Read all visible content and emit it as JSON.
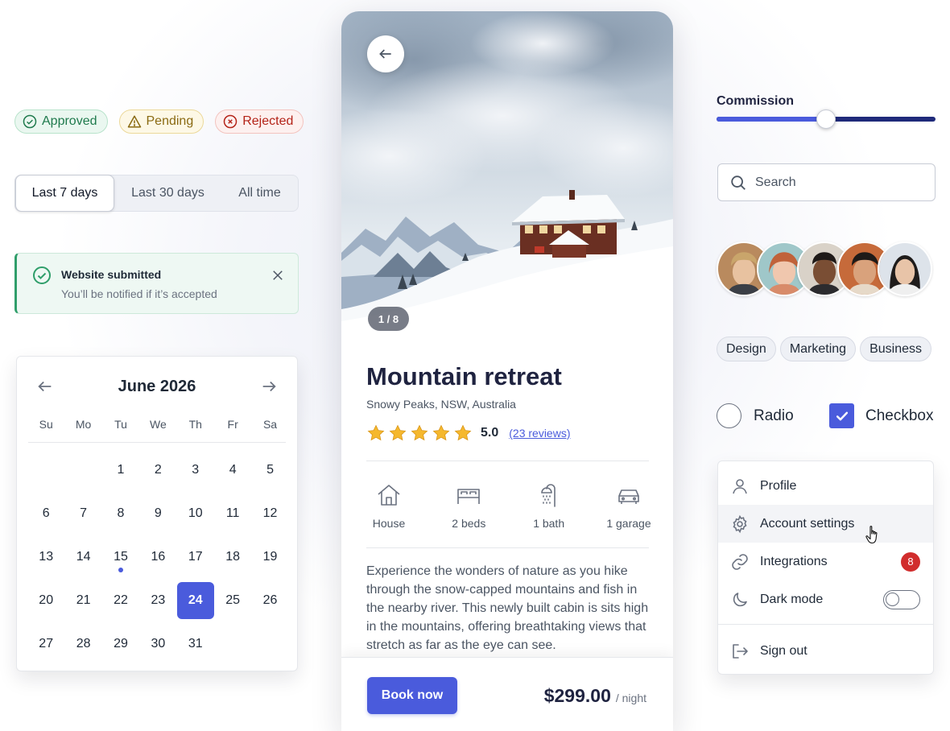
{
  "badges": [
    {
      "label": "Approved",
      "icon": "check-circle-icon",
      "color": "#1f7a4d"
    },
    {
      "label": "Pending",
      "icon": "warning-triangle-icon",
      "color": "#8a6a12"
    },
    {
      "label": "Rejected",
      "icon": "x-circle-icon",
      "color": "#b42318"
    }
  ],
  "segmented": {
    "options": [
      "Last 7 days",
      "Last 30 days",
      "All time"
    ],
    "selected": "Last 7 days"
  },
  "alert": {
    "title": "Website submitted",
    "message": "You’ll be notified if it’s accepted",
    "icon": "check-circle-icon"
  },
  "calendar": {
    "month": "June 2026",
    "weekdays": [
      "Su",
      "Mo",
      "Tu",
      "We",
      "Th",
      "Fr",
      "Sa"
    ],
    "days": [
      "",
      "",
      "1",
      "2",
      "3",
      "4",
      "5",
      "6",
      "7",
      "8",
      "9",
      "10",
      "11",
      "12",
      "13",
      "14",
      "15",
      "16",
      "17",
      "18",
      "19",
      "20",
      "21",
      "22",
      "23",
      "24",
      "25",
      "26",
      "27",
      "28",
      "29",
      "30",
      "31"
    ],
    "selected_day": "24",
    "marked_day": "15"
  },
  "listing": {
    "image_counter": "1 / 8",
    "title": "Mountain retreat",
    "location": "Snowy Peaks, NSW, Australia",
    "stars": 5,
    "rating": "5.0",
    "reviews": "(23 reviews)",
    "features": [
      {
        "icon": "house-icon",
        "label": "House"
      },
      {
        "icon": "bed-icon",
        "label": "2 beds"
      },
      {
        "icon": "shower-icon",
        "label": "1 bath"
      },
      {
        "icon": "car-icon",
        "label": "1 garage"
      }
    ],
    "description": "Experience the wonders of nature as you hike through the snow-capped mountains and fish in the nearby river. This newly built cabin is sits high in the mountains, offering breathtaking views that stretch as far as the eye can see.",
    "book_label": "Book now",
    "price": "$299.00",
    "price_unit": "/ night"
  },
  "commission": {
    "label": "Commission",
    "value_fraction": 0.5
  },
  "search": {
    "placeholder": "Search"
  },
  "tags": [
    "Design",
    "Marketing",
    "Business"
  ],
  "controls": {
    "radio_label": "Radio",
    "radio_checked": false,
    "checkbox_label": "Checkbox",
    "checkbox_checked": true
  },
  "menu": {
    "items": [
      {
        "icon": "user-icon",
        "label": "Profile"
      },
      {
        "icon": "gear-icon",
        "label": "Account settings"
      },
      {
        "icon": "link-icon",
        "label": "Integrations",
        "count": "8"
      },
      {
        "icon": "moon-icon",
        "label": "Dark mode",
        "toggle": false
      }
    ],
    "signout": {
      "icon": "sign-out-icon",
      "label": "Sign out"
    }
  },
  "colors": {
    "accent": "#4a5bdc",
    "success": "#2f9e6a",
    "danger": "#d12d2d",
    "star": "#f5b82e"
  }
}
